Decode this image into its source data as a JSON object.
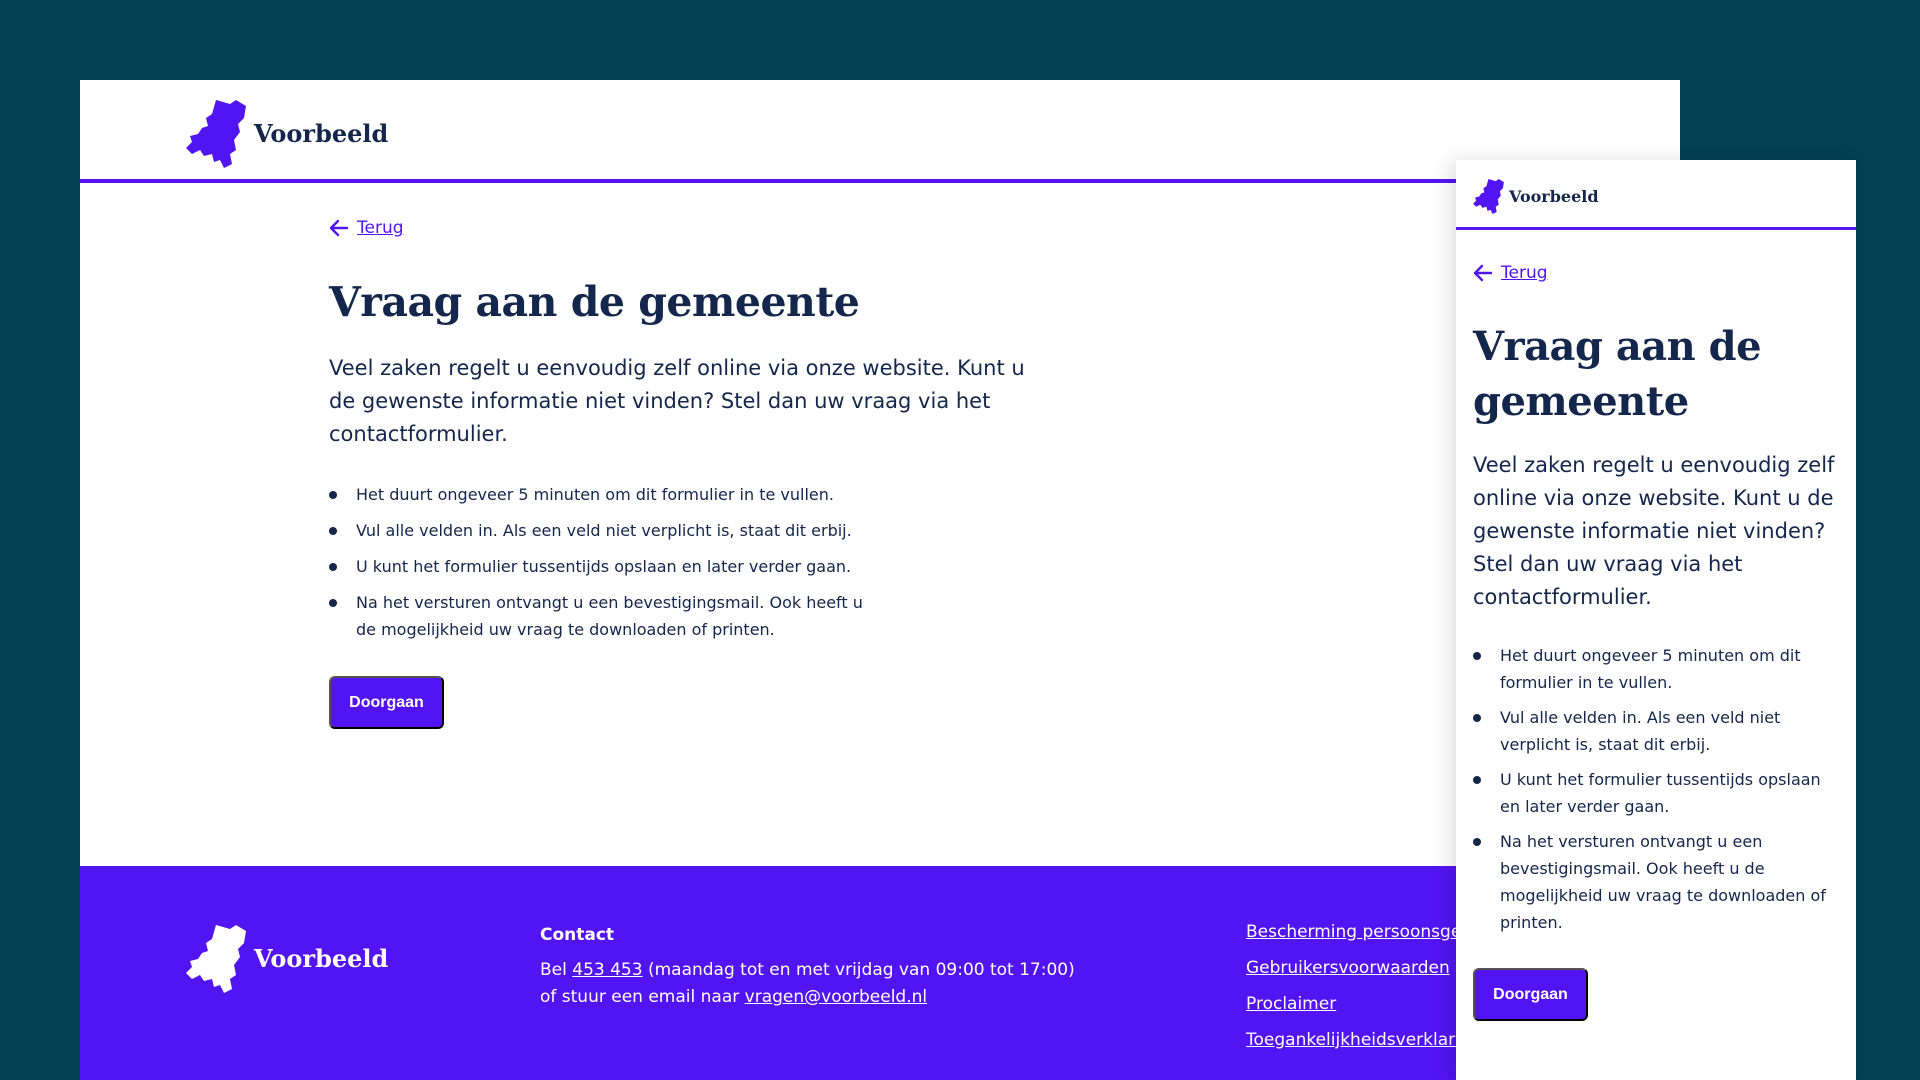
{
  "colors": {
    "background": "#004152",
    "accent": "#5314f3",
    "text": "#14264b",
    "surface": "#ffffff"
  },
  "brand": {
    "name": "Voorbeeld",
    "logo_icon": "netherlands-map-icon"
  },
  "nav": {
    "back_label": "Terug",
    "back_icon": "arrow-left-icon"
  },
  "content": {
    "title": "Vraag aan de gemeente",
    "intro": "Veel zaken regelt u eenvoudig zelf online via onze website. Kunt u de gewenste informatie niet vinden? Stel dan uw vraag via het contactformulier.",
    "bullets": [
      "Het duurt ongeveer 5 minuten om dit formulier in te vullen.",
      "Vul alle velden in. Als een veld niet verplicht is, staat dit erbij.",
      "U kunt het formulier tussentijds opslaan en later verder gaan.",
      "Na het versturen ontvangt u een bevestigingsmail. Ook heeft u de mogelijkheid uw vraag te downloaden of printen."
    ],
    "continue_label": "Doorgaan"
  },
  "footer": {
    "contact_heading": "Contact",
    "phone_prefix": "Bel ",
    "phone_number": "453 453",
    "phone_hours": " (maandag tot en met vrijdag van 09:00 tot 17:00)",
    "email_prefix": "of stuur een email naar ",
    "email": "vragen@voorbeeld.nl",
    "links": [
      "Bescherming persoonsgegevens",
      "Gebruikersvoorwaarden",
      "Proclaimer",
      "Toegankelijkheidsverklaring"
    ]
  }
}
